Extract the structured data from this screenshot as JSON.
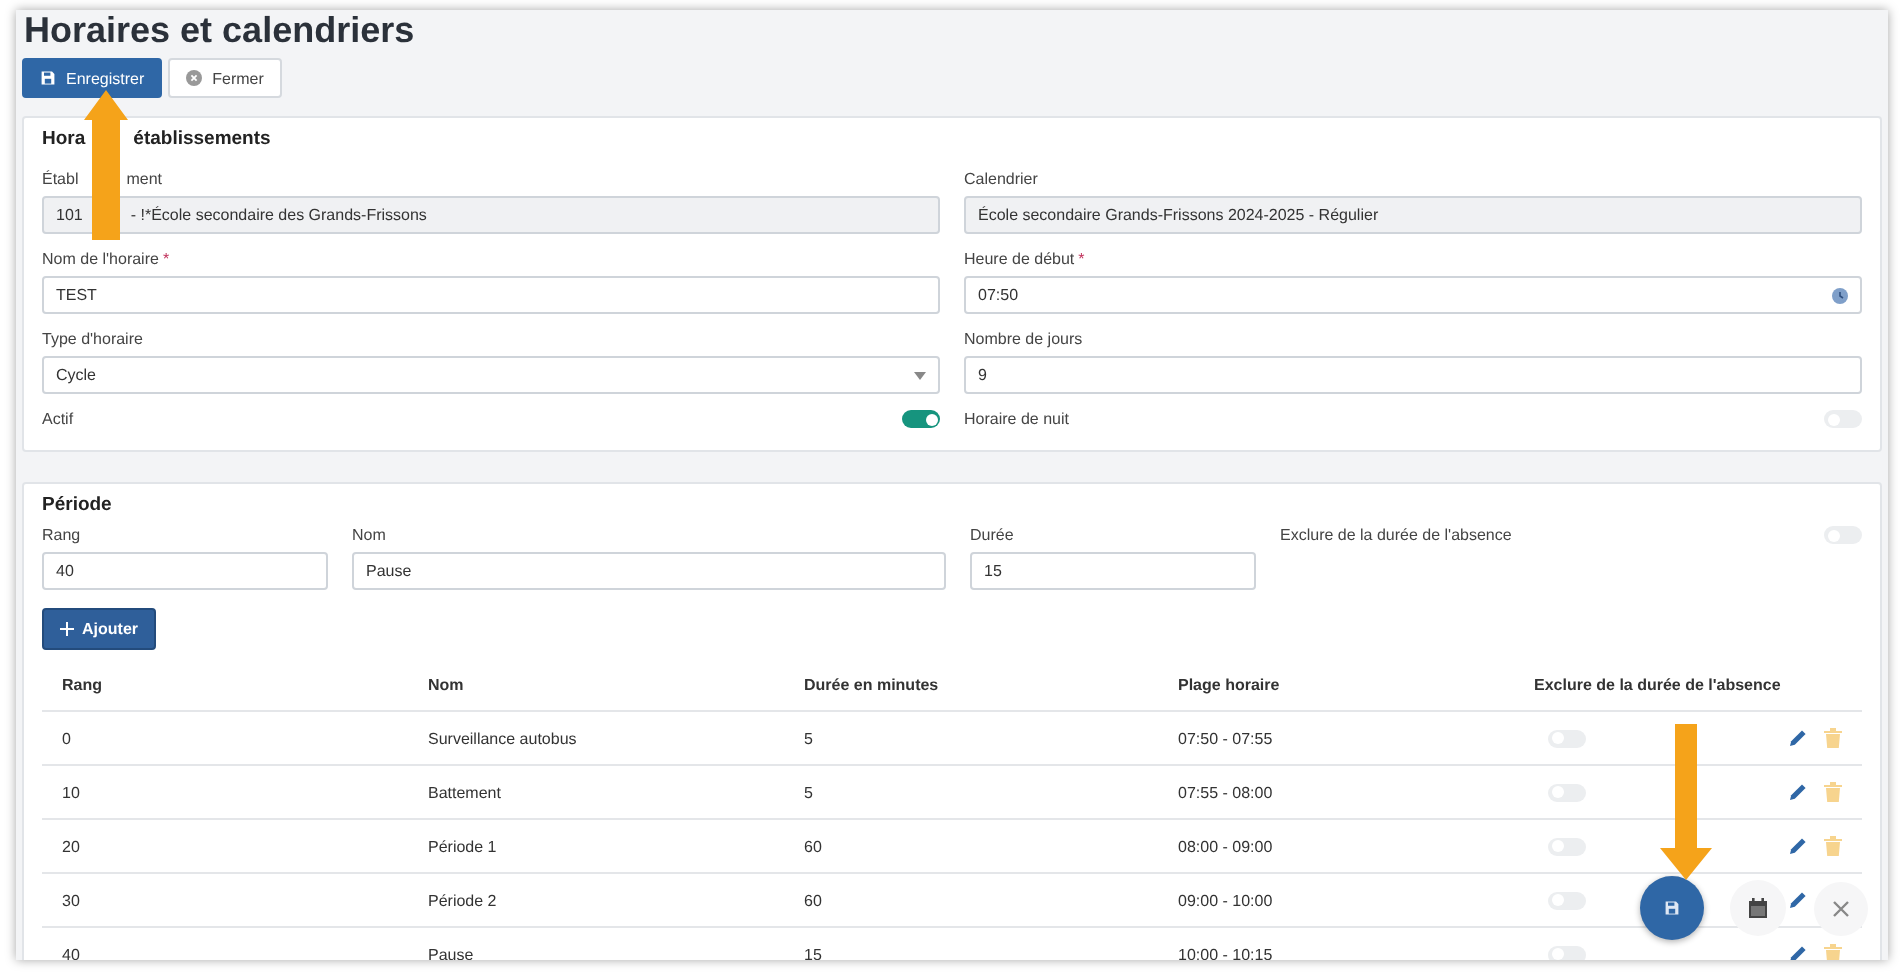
{
  "page": {
    "title": "Horaires et calendriers"
  },
  "toolbar": [
    {
      "label": "Enregistrer",
      "kind": "primary"
    },
    {
      "label": "Fermer",
      "kind": "secondary"
    }
  ],
  "schedule_section": {
    "title_parts": [
      "Hora",
      "établissements"
    ],
    "fields": [
      {
        "label_parts": [
          "Établ",
          "ment"
        ],
        "kind": "text",
        "value_parts": [
          "101",
          "- !*École secondaire des Grands-Frissons"
        ],
        "readonly": true
      },
      {
        "label": "Calendrier",
        "kind": "text",
        "value": "École secondaire Grands-Frissons 2024-2025 - Régulier",
        "readonly": true
      },
      {
        "label": "Nom de l'horaire",
        "required_mark": "*",
        "kind": "text",
        "value": "TEST",
        "readonly": false
      },
      {
        "label": "Heure de début",
        "required_mark": "*",
        "kind": "time",
        "value": "07:50",
        "readonly": false
      },
      {
        "label": "Type d'horaire",
        "kind": "select",
        "value": "Cycle",
        "readonly": false
      },
      {
        "label": "Nombre de jours",
        "kind": "text",
        "value": "9",
        "readonly": false
      },
      {
        "label": "Actif",
        "kind": "toggle",
        "on": true
      },
      {
        "label": "Horaire de nuit",
        "kind": "toggle",
        "on": false
      }
    ]
  },
  "period_section": {
    "title": "Période",
    "fields": [
      {
        "label": "Rang",
        "kind": "text",
        "value": "40"
      },
      {
        "label": "Nom",
        "kind": "text",
        "value": "Pause"
      },
      {
        "label": "Durée",
        "kind": "text",
        "value": "15"
      },
      {
        "label": "Exclure de la durée de l'absence",
        "kind": "toggle",
        "on": false
      }
    ],
    "add_button": "Ajouter",
    "table": {
      "columns": [
        "Rang",
        "Nom",
        "Durée en minutes",
        "Plage horaire",
        "Exclure de la durée de l'absence"
      ],
      "rows": [
        {
          "rank": "0",
          "name": "Surveillance autobus",
          "duration": "5",
          "range": "07:50 - 07:55",
          "exclude": false
        },
        {
          "rank": "10",
          "name": "Battement",
          "duration": "5",
          "range": "07:55 - 08:00",
          "exclude": false
        },
        {
          "rank": "20",
          "name": "Période 1",
          "duration": "60",
          "range": "08:00 - 09:00",
          "exclude": false
        },
        {
          "rank": "30",
          "name": "Période 2",
          "duration": "60",
          "range": "09:00 - 10:00",
          "exclude": false
        },
        {
          "rank": "40",
          "name": "Pause",
          "duration": "15",
          "range": "10:00 - 10:15",
          "exclude": false
        }
      ]
    }
  }
}
